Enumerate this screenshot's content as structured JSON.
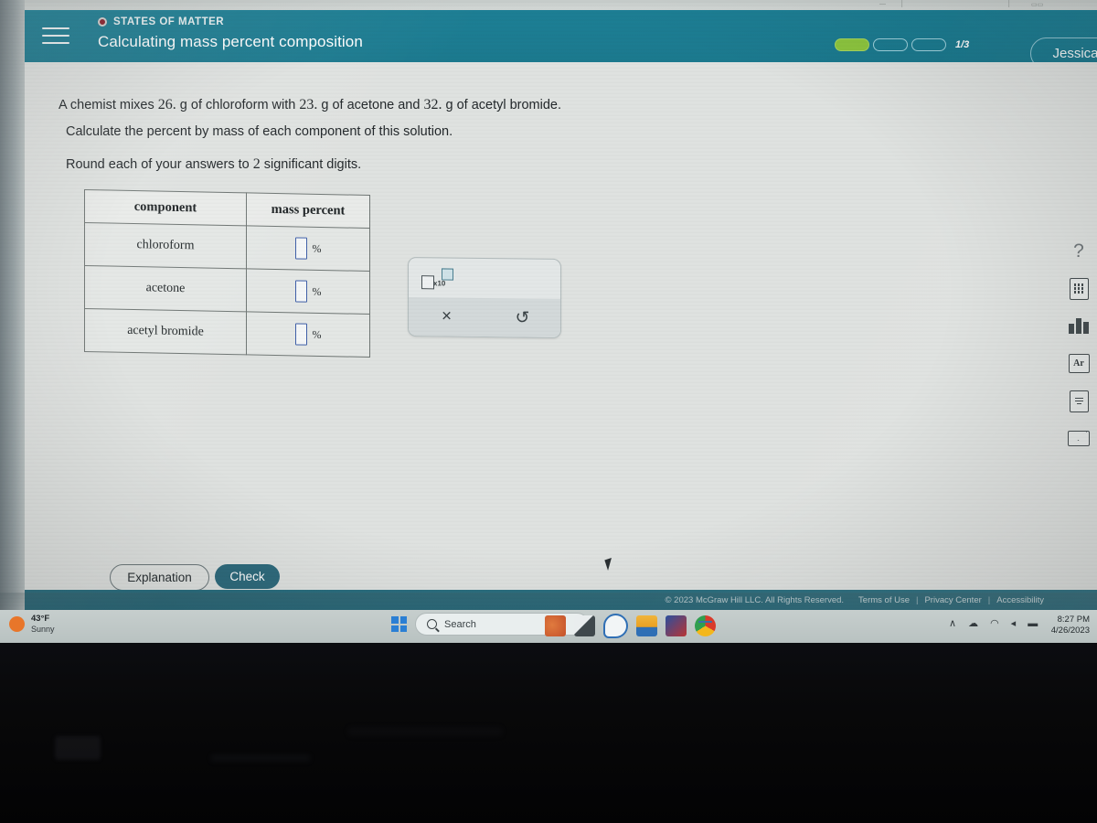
{
  "header": {
    "topic_label": "STATES OF MATTER",
    "page_title": "Calculating mass percent composition",
    "progress_text": "1/3",
    "progress_total": 3,
    "progress_filled": 1,
    "user_name": "Jessica",
    "menu_icon": "hamburger-icon",
    "topic_dot_icon": "record-dot-icon",
    "chevron_icon": "chevron-down-icon",
    "teal": "#1d8096",
    "progress_fill_color": "#8dc63f"
  },
  "collapse": {
    "icon": "chevron-down-icon"
  },
  "question": {
    "line1_a": "A chemist mixes ",
    "line1_n1": "26.",
    "line1_b": " g of chloroform with ",
    "line1_n2": "23.",
    "line1_c": " g of acetone and ",
    "line1_n3": "32.",
    "line1_d": " g of acetyl bromide.",
    "line2": "Calculate the percent by mass of each component of this solution.",
    "line3_a": "Round each of your answers to ",
    "line3_n": "2",
    "line3_b": " significant digits."
  },
  "table": {
    "headers": [
      "component",
      "mass percent"
    ],
    "rows": [
      {
        "component": "chloroform",
        "value": "",
        "unit": "%"
      },
      {
        "component": "acetone",
        "value": "",
        "unit": "%"
      },
      {
        "component": "acetyl bromide",
        "value": "",
        "unit": "%"
      }
    ]
  },
  "mathbar": {
    "sci_notation_label": "x10",
    "sci_notation_icon": "scientific-notation-icon",
    "clear_icon": "×",
    "undo_icon": "↺"
  },
  "rail": {
    "items": [
      {
        "icon": "help-question-icon",
        "glyph": "?"
      },
      {
        "icon": "calculator-icon",
        "glyph": ""
      },
      {
        "icon": "bar-chart-icon",
        "glyph": ""
      },
      {
        "icon": "periodic-table-icon",
        "glyph": "Ar"
      },
      {
        "icon": "reference-book-icon",
        "glyph": ""
      },
      {
        "icon": "envelope-icon",
        "glyph": ""
      }
    ]
  },
  "actions": {
    "explanation_label": "Explanation",
    "check_label": "Check"
  },
  "footer": {
    "copyright": "© 2023 McGraw Hill LLC. All Rights Reserved.",
    "terms": "Terms of Use",
    "privacy": "Privacy Center",
    "accessibility": "Accessibility",
    "separator": "|"
  },
  "taskbar": {
    "weather_temp": "43°F",
    "weather_condition": "Sunny",
    "weather_icon": "sun-icon",
    "start_icon": "windows-logo-icon",
    "search_placeholder": "Search",
    "search_icon": "search-icon",
    "apps": [
      {
        "name": "widgets-app-icon"
      },
      {
        "name": "teams-app-icon"
      },
      {
        "name": "chat-app-icon"
      },
      {
        "name": "file-explorer-icon"
      },
      {
        "name": "office-app-icon"
      },
      {
        "name": "chrome-app-icon"
      }
    ],
    "tray": [
      {
        "icon": "show-hidden-icons-chevron",
        "glyph": "∧"
      },
      {
        "icon": "cloud-icon",
        "glyph": "☁"
      },
      {
        "icon": "wifi-icon",
        "glyph": "◠"
      },
      {
        "icon": "volume-icon",
        "glyph": "◂"
      },
      {
        "icon": "battery-icon",
        "glyph": "▬"
      }
    ],
    "clock_time": "8:27 PM",
    "clock_date": "4/26/2023"
  }
}
